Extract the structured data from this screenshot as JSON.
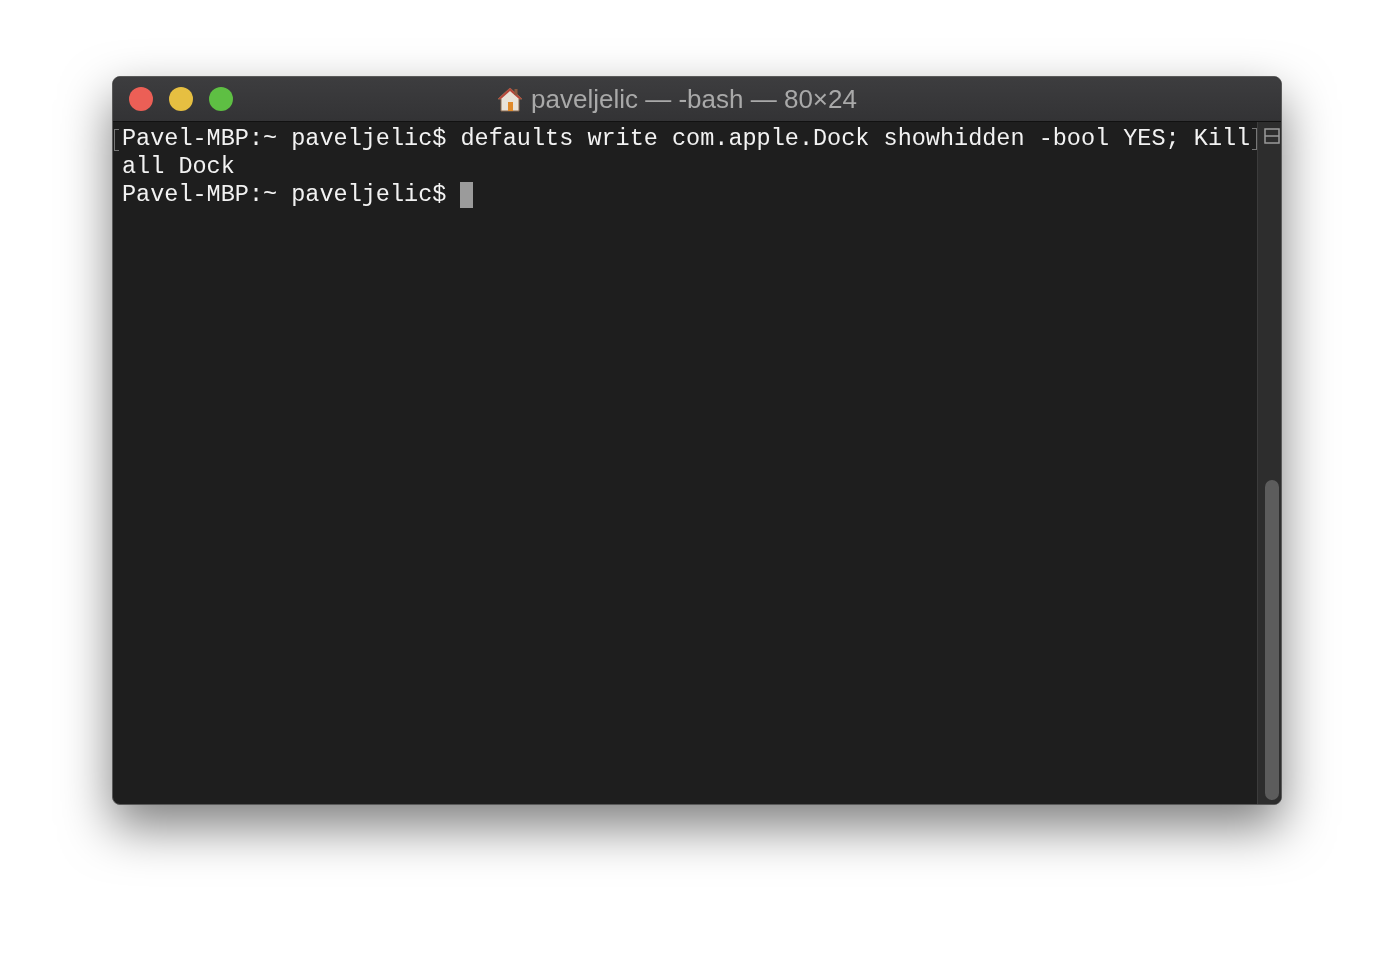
{
  "window": {
    "title": "paveljelic — -bash — 80×24"
  },
  "terminal": {
    "lines": [
      {
        "text": "Pavel-MBP:~ paveljelic$ defaults write com.apple.Dock showhidden -bool YES; Kill",
        "marked": true,
        "cursor": false
      },
      {
        "text": "all Dock",
        "marked": false,
        "cursor": false
      },
      {
        "text": "Pavel-MBP:~ paveljelic$ ",
        "marked": false,
        "cursor": true
      }
    ]
  }
}
